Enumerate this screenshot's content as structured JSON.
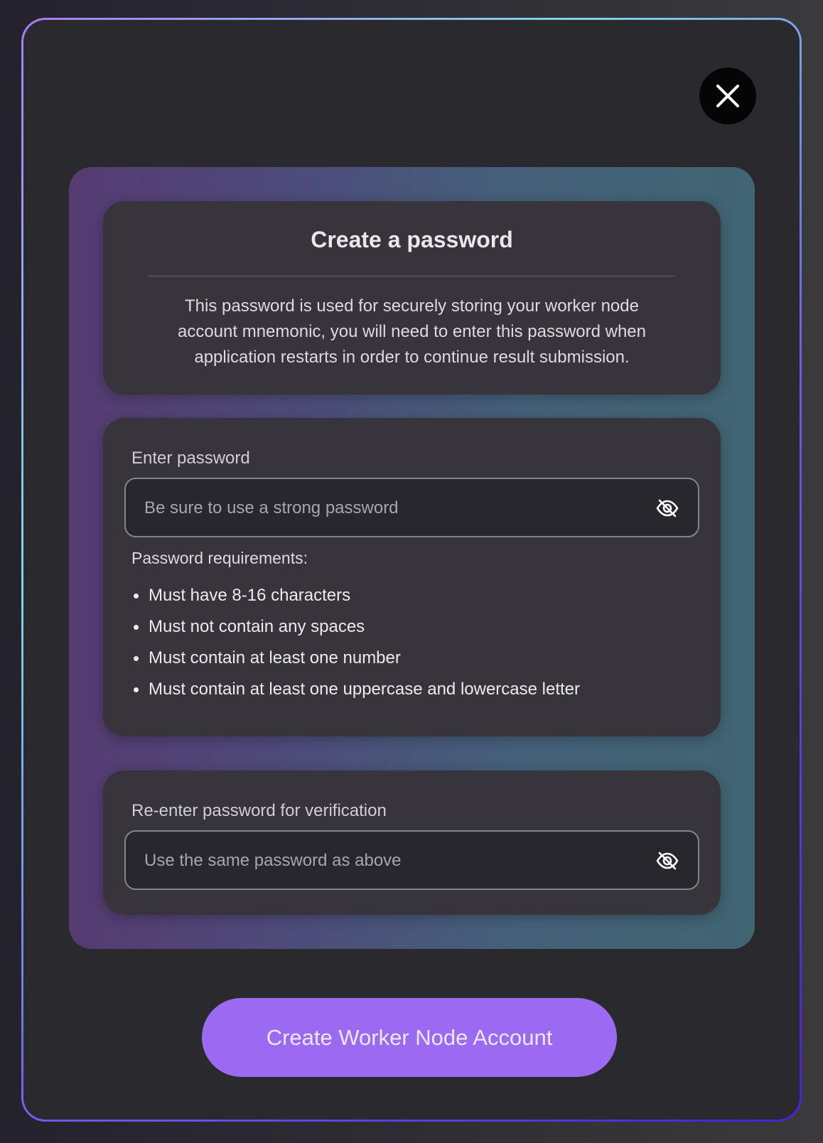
{
  "dialog": {
    "title": "Create a password",
    "description": "This password is used for securely storing your worker node account mnemonic, you will need to enter this password when application restarts in order to continue result submission.",
    "close_icon": "close-icon"
  },
  "password": {
    "label": "Enter password",
    "placeholder": "Be sure to use a strong password",
    "value": "",
    "toggle_icon": "eye-off-icon",
    "requirements_label": "Password requirements:",
    "requirements": [
      "Must have 8-16 characters",
      "Must not contain any spaces",
      "Must contain at least one number",
      "Must contain at least one uppercase and lowercase letter"
    ]
  },
  "verify": {
    "label": "Re-enter password for verification",
    "placeholder": "Use the same password as above",
    "value": "",
    "toggle_icon": "eye-off-icon"
  },
  "submit": {
    "label": "Create Worker Node Account"
  },
  "colors": {
    "accent": "#9b6af2",
    "card": "#37353b",
    "modal": "#2a292e"
  }
}
